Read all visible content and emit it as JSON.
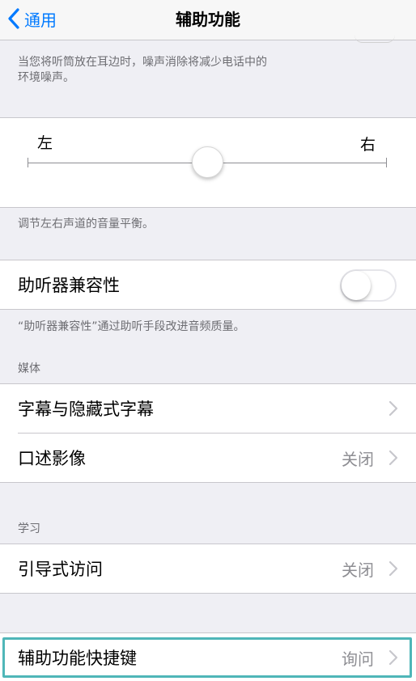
{
  "nav": {
    "back_label": "通用",
    "title": "辅助功能"
  },
  "noise_footer": {
    "line1": "当您将听筒放在耳边时，噪声消除将减少电话中的",
    "line2": "环境噪声。"
  },
  "balance": {
    "left_label": "左",
    "right_label": "右",
    "value": 0.5,
    "footer": "调节左右声道的音量平衡。"
  },
  "hearing_aid": {
    "label": "助听器兼容性",
    "enabled": false,
    "footer": "“助听器兼容性”通过助听手段改进音频质量。"
  },
  "media": {
    "header": "媒体",
    "items": [
      {
        "label": "字幕与隐藏式字幕",
        "value": ""
      },
      {
        "label": "口述影像",
        "value": "关闭"
      }
    ]
  },
  "learning": {
    "header": "学习",
    "items": [
      {
        "label": "引导式访问",
        "value": "关闭"
      }
    ]
  },
  "shortcut": {
    "label": "辅助功能快捷键",
    "value": "询问"
  },
  "colors": {
    "accent": "#007aff",
    "highlight": "#4fb6b8",
    "secondary_text": "#8e8e93",
    "background": "#efeff4"
  }
}
